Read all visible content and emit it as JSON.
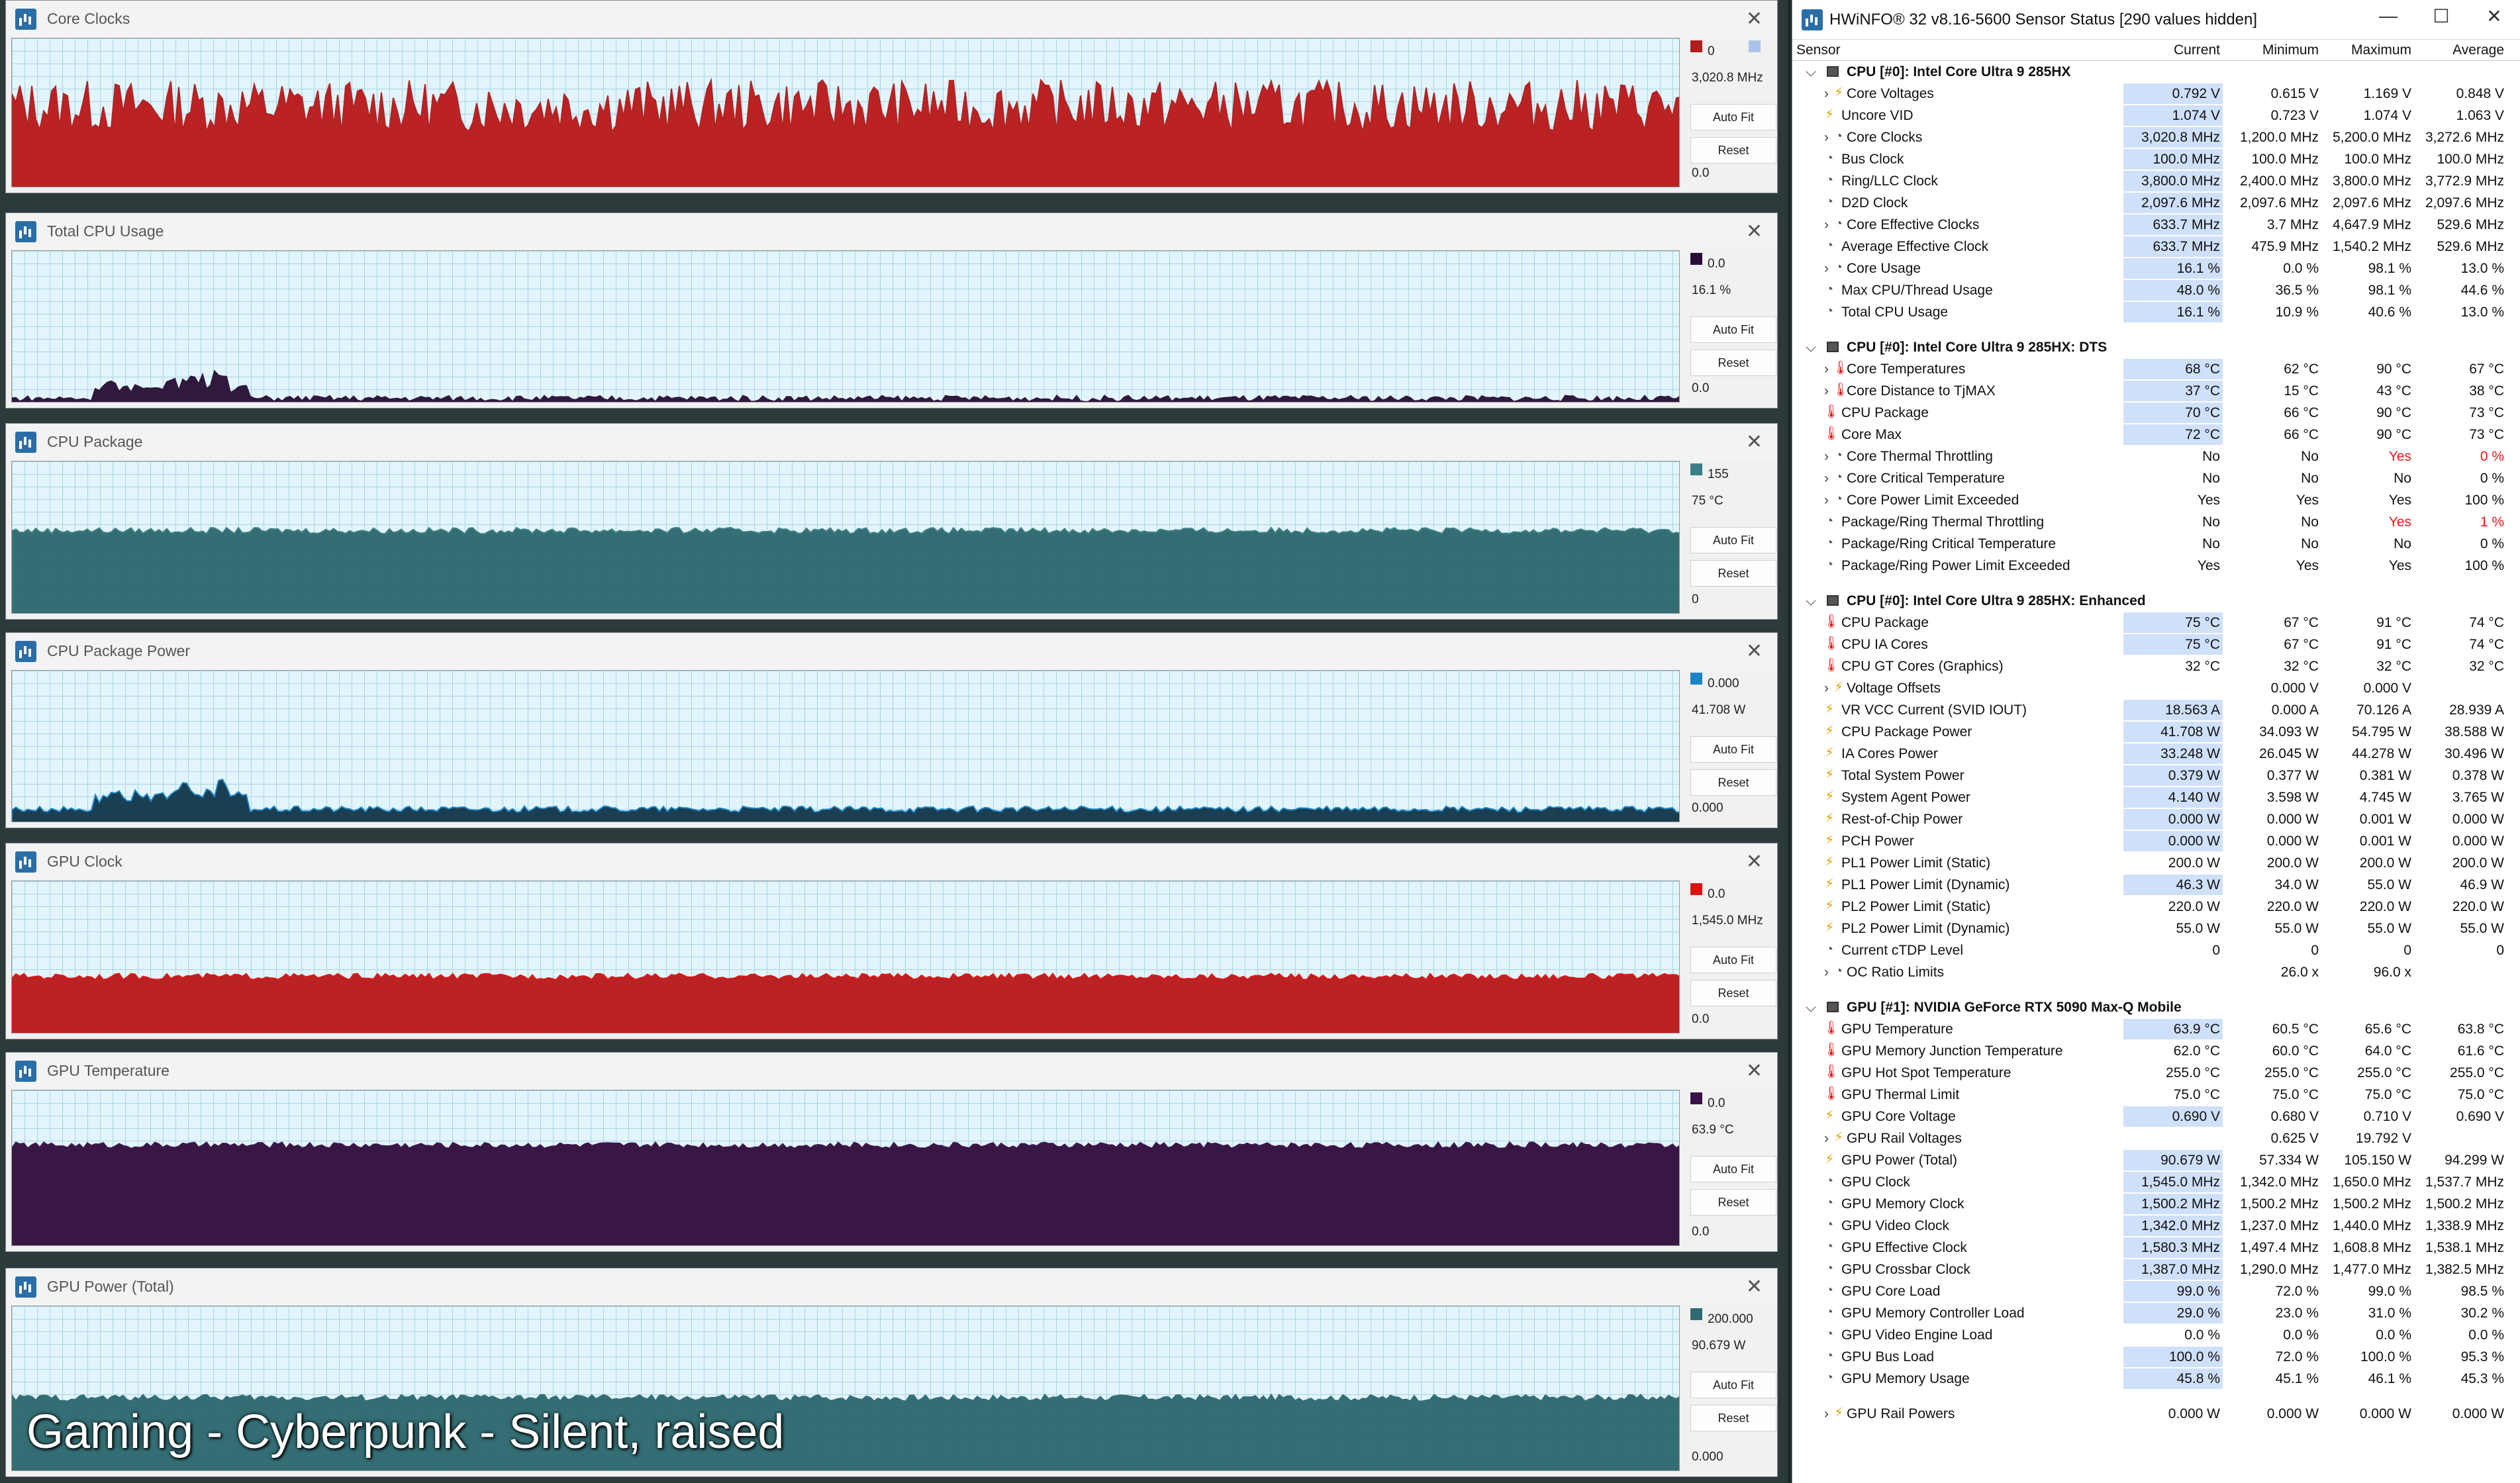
{
  "caption": "Gaming - Cyberpunk - Silent, raised",
  "graphs": [
    {
      "title": "Core Clocks",
      "max": "0",
      "current": "3,020.8 MHz",
      "min": "0.0",
      "color": "#b01e1e",
      "fill": "#b91c1c",
      "level": 0.55,
      "extra_swatch": true,
      "spiky": true
    },
    {
      "title": "Total CPU Usage",
      "max": "0.0",
      "current": "16.1 %",
      "min": "0.0",
      "color": "#2a1038",
      "fill": "#2c1238",
      "level": 0.04,
      "extra_swatch": false,
      "spiky": false,
      "bump": true
    },
    {
      "title": "CPU Package",
      "max": "155",
      "current": "75 °C",
      "min": "0",
      "color": "#3a7f85",
      "fill": "#2f6a70",
      "level": 0.55,
      "extra_swatch": false,
      "spiky": false
    },
    {
      "title": "CPU Package Power",
      "max": "0.000",
      "current": "41.708 W",
      "min": "0.000",
      "color": "#1a84c7",
      "fill": "#143a4d",
      "level": 0.1,
      "extra_swatch": false,
      "spiky": false,
      "bump": true
    },
    {
      "title": "GPU Clock",
      "max": "0.0",
      "current": "1,545.0 MHz",
      "min": "0.0",
      "color": "#d11",
      "fill": "#b91c1c",
      "level": 0.38,
      "extra_swatch": false,
      "spiky": false
    },
    {
      "title": "GPU Temperature",
      "max": "0.0",
      "current": "63.9 °C",
      "min": "0.0",
      "color": "#3a1048",
      "fill": "#33103f",
      "level": 0.65,
      "extra_swatch": false,
      "spiky": false
    },
    {
      "title": "GPU Power (Total)",
      "max": "200.000",
      "current": "90.679 W",
      "min": "0.000",
      "color": "#2f6a70",
      "fill": "#2f6a70",
      "level": 0.45,
      "extra_swatch": false,
      "spiky": false
    }
  ],
  "buttons": {
    "autofit": "Auto Fit",
    "reset": "Reset"
  },
  "hwinfo": {
    "title": "HWiNFO® 32 v8.16-5600 Sensor Status [290 values hidden]",
    "controls": {
      "minimize": "—",
      "maximize": "☐",
      "close": "✕"
    },
    "headers": {
      "sensor": "Sensor",
      "current": "Current",
      "minimum": "Minimum",
      "maximum": "Maximum",
      "average": "Average"
    },
    "rows": [
      {
        "t": "g",
        "label": "CPU [#0]: Intel Core Ultra 9 285HX"
      },
      {
        "t": "r",
        "i": "bolt",
        "exp": true,
        "label": "Core Voltages",
        "c": "0.792 V",
        "mn": "0.615 V",
        "mx": "1.169 V",
        "av": "0.848 V",
        "hl": true
      },
      {
        "t": "r",
        "i": "bolt",
        "label": "Uncore VID",
        "c": "1.074 V",
        "mn": "0.723 V",
        "mx": "1.074 V",
        "av": "1.063 V",
        "hl": true
      },
      {
        "t": "r",
        "i": "clk",
        "exp": true,
        "label": "Core Clocks",
        "c": "3,020.8 MHz",
        "mn": "1,200.0 MHz",
        "mx": "5,200.0 MHz",
        "av": "3,272.6 MHz",
        "hl": true
      },
      {
        "t": "r",
        "i": "clk",
        "label": "Bus Clock",
        "c": "100.0 MHz",
        "mn": "100.0 MHz",
        "mx": "100.0 MHz",
        "av": "100.0 MHz",
        "hl": true
      },
      {
        "t": "r",
        "i": "clk",
        "label": "Ring/LLC Clock",
        "c": "3,800.0 MHz",
        "mn": "2,400.0 MHz",
        "mx": "3,800.0 MHz",
        "av": "3,772.9 MHz",
        "hl": true
      },
      {
        "t": "r",
        "i": "clk",
        "label": "D2D Clock",
        "c": "2,097.6 MHz",
        "mn": "2,097.6 MHz",
        "mx": "2,097.6 MHz",
        "av": "2,097.6 MHz",
        "hl": true
      },
      {
        "t": "r",
        "i": "clk",
        "exp": true,
        "label": "Core Effective Clocks",
        "c": "633.7 MHz",
        "mn": "3.7 MHz",
        "mx": "4,647.9 MHz",
        "av": "529.6 MHz",
        "hl": true
      },
      {
        "t": "r",
        "i": "clk",
        "label": "Average Effective Clock",
        "c": "633.7 MHz",
        "mn": "475.9 MHz",
        "mx": "1,540.2 MHz",
        "av": "529.6 MHz",
        "hl": true
      },
      {
        "t": "r",
        "i": "clk",
        "exp": true,
        "label": "Core Usage",
        "c": "16.1 %",
        "mn": "0.0 %",
        "mx": "98.1 %",
        "av": "13.0 %",
        "hl": true
      },
      {
        "t": "r",
        "i": "clk",
        "label": "Max CPU/Thread Usage",
        "c": "48.0 %",
        "mn": "36.5 %",
        "mx": "98.1 %",
        "av": "44.6 %",
        "hl": true
      },
      {
        "t": "r",
        "i": "clk",
        "label": "Total CPU Usage",
        "c": "16.1 %",
        "mn": "10.9 %",
        "mx": "40.6 %",
        "av": "13.0 %",
        "hl": true
      },
      {
        "t": "s"
      },
      {
        "t": "g",
        "label": "CPU [#0]: Intel Core Ultra 9 285HX: DTS"
      },
      {
        "t": "r",
        "i": "tmp",
        "exp": true,
        "label": "Core Temperatures",
        "c": "68 °C",
        "mn": "62 °C",
        "mx": "90 °C",
        "av": "67 °C",
        "hl": true
      },
      {
        "t": "r",
        "i": "tmp",
        "exp": true,
        "label": "Core Distance to TjMAX",
        "c": "37 °C",
        "mn": "15 °C",
        "mx": "43 °C",
        "av": "38 °C",
        "hl": true
      },
      {
        "t": "r",
        "i": "tmp",
        "label": "CPU Package",
        "c": "70 °C",
        "mn": "66 °C",
        "mx": "90 °C",
        "av": "73 °C",
        "hl": true
      },
      {
        "t": "r",
        "i": "tmp",
        "label": "Core Max",
        "c": "72 °C",
        "mn": "66 °C",
        "mx": "90 °C",
        "av": "73 °C",
        "hl": true
      },
      {
        "t": "r",
        "i": "clk",
        "exp": true,
        "label": "Core Thermal Throttling",
        "c": "No",
        "mn": "No",
        "mx": "Yes",
        "av": "0 %",
        "red": true
      },
      {
        "t": "r",
        "i": "clk",
        "exp": true,
        "label": "Core Critical Temperature",
        "c": "No",
        "mn": "No",
        "mx": "No",
        "av": "0 %"
      },
      {
        "t": "r",
        "i": "clk",
        "exp": true,
        "label": "Core Power Limit Exceeded",
        "c": "Yes",
        "mn": "Yes",
        "mx": "Yes",
        "av": "100 %"
      },
      {
        "t": "r",
        "i": "clk",
        "label": "Package/Ring Thermal Throttling",
        "c": "No",
        "mn": "No",
        "mx": "Yes",
        "av": "1 %",
        "red": true
      },
      {
        "t": "r",
        "i": "clk",
        "label": "Package/Ring Critical Temperature",
        "c": "No",
        "mn": "No",
        "mx": "No",
        "av": "0 %"
      },
      {
        "t": "r",
        "i": "clk",
        "label": "Package/Ring Power Limit Exceeded",
        "c": "Yes",
        "mn": "Yes",
        "mx": "Yes",
        "av": "100 %"
      },
      {
        "t": "s"
      },
      {
        "t": "g",
        "label": "CPU [#0]: Intel Core Ultra 9 285HX: Enhanced"
      },
      {
        "t": "r",
        "i": "tmp",
        "label": "CPU Package",
        "c": "75 °C",
        "mn": "67 °C",
        "mx": "91 °C",
        "av": "74 °C",
        "hl": true
      },
      {
        "t": "r",
        "i": "tmp",
        "label": "CPU IA Cores",
        "c": "75 °C",
        "mn": "67 °C",
        "mx": "91 °C",
        "av": "74 °C",
        "hl": true
      },
      {
        "t": "r",
        "i": "tmp",
        "label": "CPU GT Cores (Graphics)",
        "c": "32 °C",
        "mn": "32 °C",
        "mx": "32 °C",
        "av": "32 °C"
      },
      {
        "t": "r",
        "i": "bolt",
        "exp": true,
        "label": "Voltage Offsets",
        "c": "",
        "mn": "0.000 V",
        "mx": "0.000 V",
        "av": ""
      },
      {
        "t": "r",
        "i": "bolt",
        "label": "VR VCC Current (SVID IOUT)",
        "c": "18.563 A",
        "mn": "0.000 A",
        "mx": "70.126 A",
        "av": "28.939 A",
        "hl": true
      },
      {
        "t": "r",
        "i": "bolt",
        "label": "CPU Package Power",
        "c": "41.708 W",
        "mn": "34.093 W",
        "mx": "54.795 W",
        "av": "38.588 W",
        "hl": true
      },
      {
        "t": "r",
        "i": "bolt",
        "label": "IA Cores Power",
        "c": "33.248 W",
        "mn": "26.045 W",
        "mx": "44.278 W",
        "av": "30.496 W",
        "hl": true
      },
      {
        "t": "r",
        "i": "bolt",
        "label": "Total System Power",
        "c": "0.379 W",
        "mn": "0.377 W",
        "mx": "0.381 W",
        "av": "0.378 W",
        "hl": true
      },
      {
        "t": "r",
        "i": "bolt",
        "label": "System Agent Power",
        "c": "4.140 W",
        "mn": "3.598 W",
        "mx": "4.745 W",
        "av": "3.765 W",
        "hl": true
      },
      {
        "t": "r",
        "i": "bolt",
        "label": "Rest-of-Chip Power",
        "c": "0.000 W",
        "mn": "0.000 W",
        "mx": "0.001 W",
        "av": "0.000 W",
        "hl": true
      },
      {
        "t": "r",
        "i": "bolt",
        "label": "PCH Power",
        "c": "0.000 W",
        "mn": "0.000 W",
        "mx": "0.001 W",
        "av": "0.000 W",
        "hl": true
      },
      {
        "t": "r",
        "i": "bolt",
        "label": "PL1 Power Limit (Static)",
        "c": "200.0 W",
        "mn": "200.0 W",
        "mx": "200.0 W",
        "av": "200.0 W"
      },
      {
        "t": "r",
        "i": "bolt",
        "label": "PL1 Power Limit (Dynamic)",
        "c": "46.3 W",
        "mn": "34.0 W",
        "mx": "55.0 W",
        "av": "46.9 W",
        "hl": true
      },
      {
        "t": "r",
        "i": "bolt",
        "label": "PL2 Power Limit (Static)",
        "c": "220.0 W",
        "mn": "220.0 W",
        "mx": "220.0 W",
        "av": "220.0 W"
      },
      {
        "t": "r",
        "i": "bolt",
        "label": "PL2 Power Limit (Dynamic)",
        "c": "55.0 W",
        "mn": "55.0 W",
        "mx": "55.0 W",
        "av": "55.0 W"
      },
      {
        "t": "r",
        "i": "clk",
        "label": "Current cTDP Level",
        "c": "0",
        "mn": "0",
        "mx": "0",
        "av": "0"
      },
      {
        "t": "r",
        "i": "clk",
        "exp": true,
        "label": "OC Ratio Limits",
        "c": "",
        "mn": "26.0 x",
        "mx": "96.0 x",
        "av": ""
      },
      {
        "t": "s"
      },
      {
        "t": "g",
        "label": "GPU [#1]: NVIDIA  GeForce RTX 5090 Max-Q Mobile"
      },
      {
        "t": "r",
        "i": "tmp",
        "label": "GPU Temperature",
        "c": "63.9 °C",
        "mn": "60.5 °C",
        "mx": "65.6 °C",
        "av": "63.8 °C",
        "hl": true
      },
      {
        "t": "r",
        "i": "tmp",
        "label": "GPU Memory Junction Temperature",
        "c": "62.0 °C",
        "mn": "60.0 °C",
        "mx": "64.0 °C",
        "av": "61.6 °C"
      },
      {
        "t": "r",
        "i": "tmp",
        "label": "GPU Hot Spot Temperature",
        "c": "255.0 °C",
        "mn": "255.0 °C",
        "mx": "255.0 °C",
        "av": "255.0 °C"
      },
      {
        "t": "r",
        "i": "tmp",
        "label": "GPU Thermal Limit",
        "c": "75.0 °C",
        "mn": "75.0 °C",
        "mx": "75.0 °C",
        "av": "75.0 °C"
      },
      {
        "t": "r",
        "i": "bolt",
        "label": "GPU Core Voltage",
        "c": "0.690 V",
        "mn": "0.680 V",
        "mx": "0.710 V",
        "av": "0.690 V",
        "hl": true
      },
      {
        "t": "r",
        "i": "bolt",
        "exp": true,
        "label": "GPU Rail Voltages",
        "c": "",
        "mn": "0.625 V",
        "mx": "19.792 V",
        "av": ""
      },
      {
        "t": "r",
        "i": "bolt",
        "label": "GPU Power (Total)",
        "c": "90.679 W",
        "mn": "57.334 W",
        "mx": "105.150 W",
        "av": "94.299 W",
        "hl": true
      },
      {
        "t": "r",
        "i": "clk",
        "label": "GPU Clock",
        "c": "1,545.0 MHz",
        "mn": "1,342.0 MHz",
        "mx": "1,650.0 MHz",
        "av": "1,537.7 MHz",
        "hl": true
      },
      {
        "t": "r",
        "i": "clk",
        "label": "GPU Memory Clock",
        "c": "1,500.2 MHz",
        "mn": "1,500.2 MHz",
        "mx": "1,500.2 MHz",
        "av": "1,500.2 MHz",
        "hl": true
      },
      {
        "t": "r",
        "i": "clk",
        "label": "GPU Video Clock",
        "c": "1,342.0 MHz",
        "mn": "1,237.0 MHz",
        "mx": "1,440.0 MHz",
        "av": "1,338.9 MHz",
        "hl": true
      },
      {
        "t": "r",
        "i": "clk",
        "label": "GPU Effective Clock",
        "c": "1,580.3 MHz",
        "mn": "1,497.4 MHz",
        "mx": "1,608.8 MHz",
        "av": "1,538.1 MHz",
        "hl": true
      },
      {
        "t": "r",
        "i": "clk",
        "label": "GPU Crossbar Clock",
        "c": "1,387.0 MHz",
        "mn": "1,290.0 MHz",
        "mx": "1,477.0 MHz",
        "av": "1,382.5 MHz",
        "hl": true
      },
      {
        "t": "r",
        "i": "clk",
        "label": "GPU Core Load",
        "c": "99.0 %",
        "mn": "72.0 %",
        "mx": "99.0 %",
        "av": "98.5 %",
        "hl": true
      },
      {
        "t": "r",
        "i": "clk",
        "label": "GPU Memory Controller Load",
        "c": "29.0 %",
        "mn": "23.0 %",
        "mx": "31.0 %",
        "av": "30.2 %",
        "hl": true
      },
      {
        "t": "r",
        "i": "clk",
        "label": "GPU Video Engine Load",
        "c": "0.0 %",
        "mn": "0.0 %",
        "mx": "0.0 %",
        "av": "0.0 %"
      },
      {
        "t": "r",
        "i": "clk",
        "label": "GPU Bus Load",
        "c": "100.0 %",
        "mn": "72.0 %",
        "mx": "100.0 %",
        "av": "95.3 %",
        "hl": true
      },
      {
        "t": "r",
        "i": "clk",
        "label": "GPU Memory Usage",
        "c": "45.8 %",
        "mn": "45.1 %",
        "mx": "46.1 %",
        "av": "45.3 %",
        "hl": true
      },
      {
        "t": "s"
      },
      {
        "t": "r",
        "i": "bolt",
        "exp": true,
        "label": "GPU Rail Powers",
        "c": "0.000 W",
        "mn": "0.000 W",
        "mx": "0.000 W",
        "av": "0.000 W"
      }
    ]
  }
}
